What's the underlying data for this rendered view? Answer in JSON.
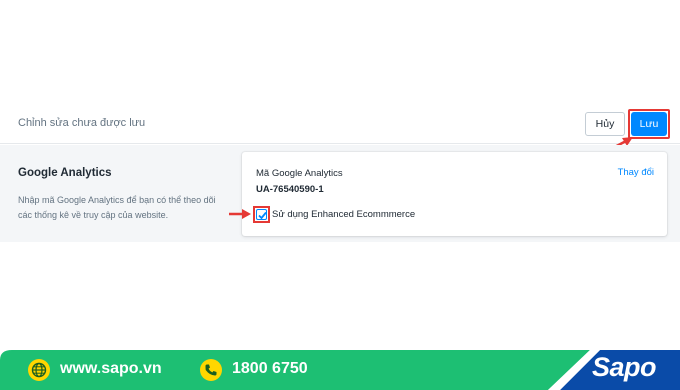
{
  "savebar": {
    "text": "Chỉnh sửa chưa được lưu",
    "cancel_label": "Hủy",
    "save_label": "Lưu"
  },
  "section": {
    "title": "Google Analytics",
    "description": "Nhập mã Google Analytics để bạn có thể theo dõi các thống kê về truy cập của website."
  },
  "card": {
    "field_label": "Mã Google Analytics",
    "field_value": "UA-76540590-1",
    "change_label": "Thay đổi",
    "checkbox_label": "Sử dụng Enhanced Ecommmerce",
    "checkbox_checked": true
  },
  "footer": {
    "website": "www.sapo.vn",
    "hotline": "1800 6750",
    "logo": "Sapo",
    "colors": {
      "green": "#1dbf73",
      "blue": "#0a4ba8",
      "yellow": "#ffd600"
    }
  },
  "colors": {
    "accent": "#0088ff",
    "highlight": "#e53935",
    "section_bg": "#f4f6f8"
  }
}
